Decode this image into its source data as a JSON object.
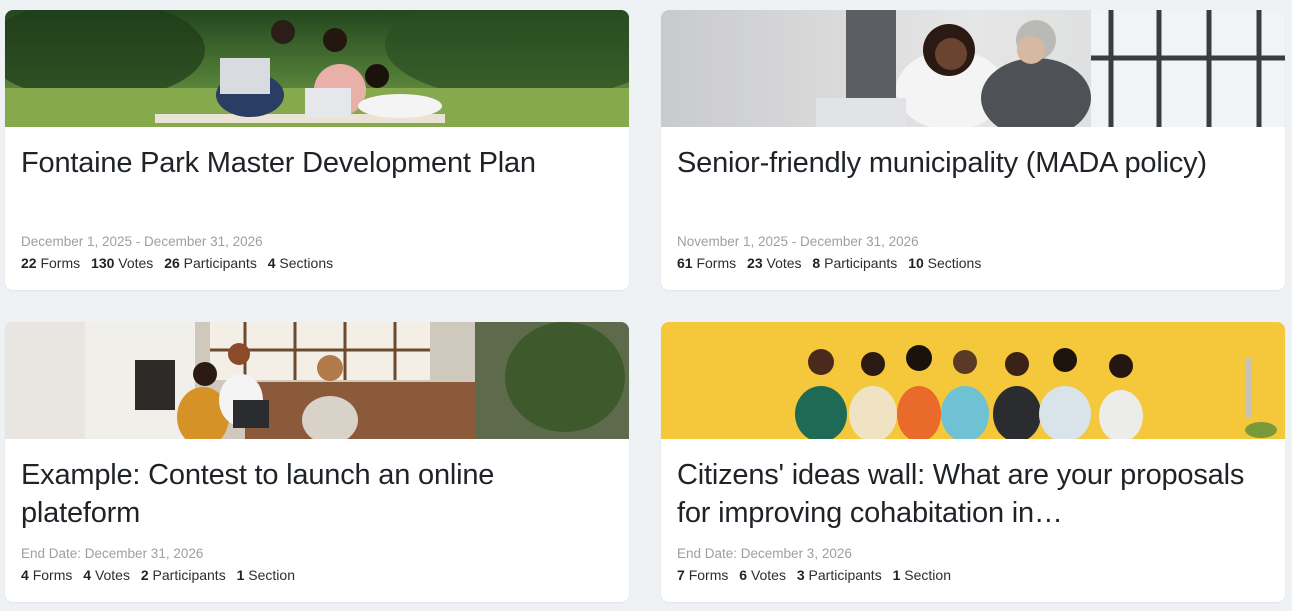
{
  "projects": [
    {
      "title": "Fontaine Park Master Development Plan",
      "date": "December 1, 2025 - December 31, 2026",
      "image_icon": "students-in-park-photo",
      "stats": [
        {
          "value": "22",
          "label": "Forms"
        },
        {
          "value": "130",
          "label": "Votes"
        },
        {
          "value": "26",
          "label": "Participants"
        },
        {
          "value": "4",
          "label": "Sections"
        }
      ]
    },
    {
      "title": "Senior-friendly municipality (MADA policy)",
      "date": "November 1, 2025 - December 31, 2026",
      "image_icon": "fist-bump-office-photo",
      "stats": [
        {
          "value": "61",
          "label": "Forms"
        },
        {
          "value": "23",
          "label": "Votes"
        },
        {
          "value": "8",
          "label": "Participants"
        },
        {
          "value": "10",
          "label": "Sections"
        }
      ]
    },
    {
      "title": "Example: Contest to launch an online plateform",
      "date": "End Date: December 31, 2026",
      "image_icon": "team-meeting-photo",
      "stats": [
        {
          "value": "4",
          "label": "Forms"
        },
        {
          "value": "4",
          "label": "Votes"
        },
        {
          "value": "2",
          "label": "Participants"
        },
        {
          "value": "1",
          "label": "Section"
        }
      ]
    },
    {
      "title": "Citizens' ideas wall: What are your proposals for improving cohabitation in…",
      "date": "End Date: December 3, 2026",
      "image_icon": "people-on-phones-yellow-wall-photo",
      "stats": [
        {
          "value": "7",
          "label": "Forms"
        },
        {
          "value": "6",
          "label": "Votes"
        },
        {
          "value": "3",
          "label": "Participants"
        },
        {
          "value": "1",
          "label": "Section"
        }
      ]
    }
  ],
  "colors": {
    "page_bg": "#eef2f5",
    "card_bg": "#ffffff",
    "title": "#1f2328",
    "date": "#9aa0a6"
  }
}
